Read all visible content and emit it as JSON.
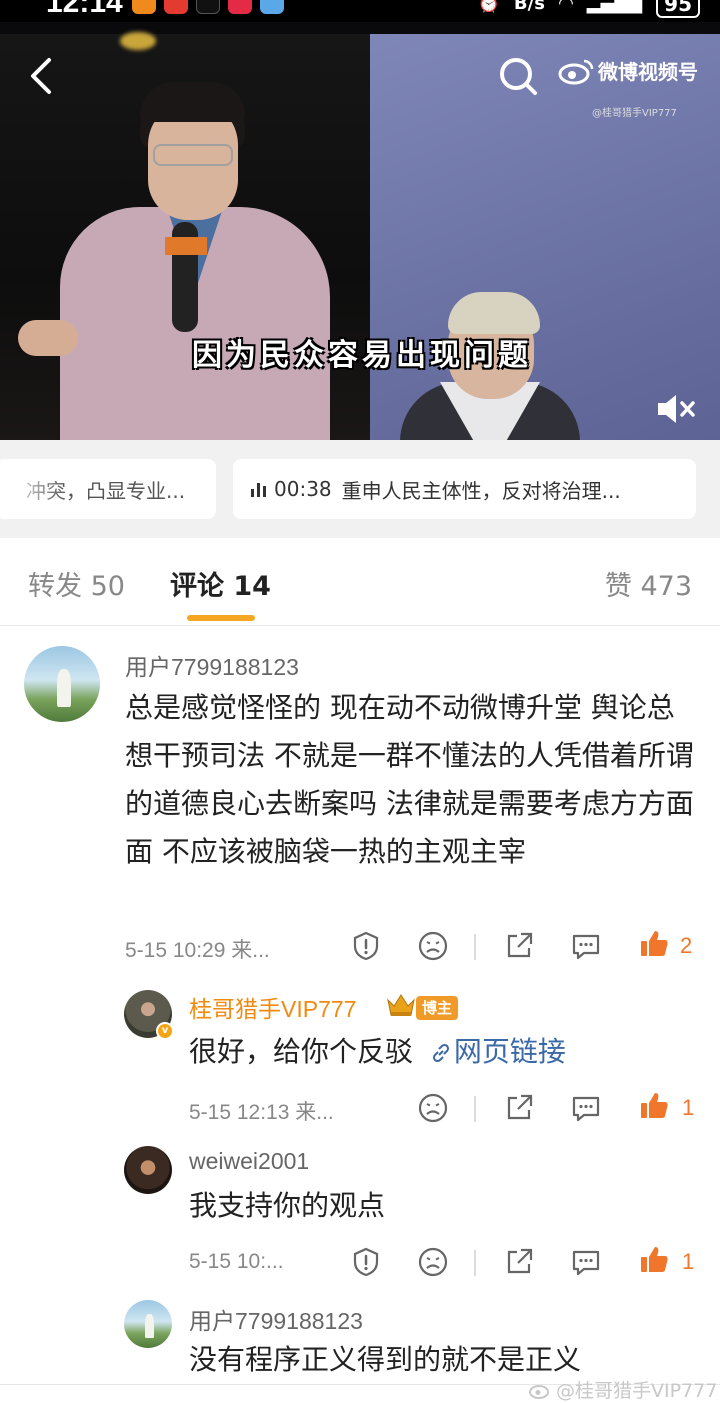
{
  "status_bar": {
    "time": "12:14",
    "net_speed": "B/s",
    "battery": "95"
  },
  "video": {
    "caption": "因为民众容易出现问题",
    "brand_name": "微博视频号",
    "brand_sub": "@桂哥猎手VIP777",
    "colors": {
      "right_backdrop": "#6d74a6"
    }
  },
  "chapters": [
    {
      "text": "冲突，凸显专业..."
    },
    {
      "time": "00:38",
      "text": "重申人民主体性，反对将治理..."
    }
  ],
  "tabs": {
    "repost": "转发 50",
    "comments": "评论 14",
    "likes": "赞 473"
  },
  "comments": [
    {
      "user": "用户7799188123",
      "text": "总是感觉怪怪的 现在动不动微博升堂 舆论总想干预司法 不就是一群不懂法的人凭借着所谓的道德良心去断案吗 法律就是需要考虑方方面面 不应该被脑袋一热的主观主宰",
      "time": "5-15 10:29 来...",
      "likes": "2"
    }
  ],
  "replies": [
    {
      "user": "桂哥猎手VIP777",
      "badge": "博主",
      "text": "很好，给你个反驳",
      "link_text": "网页链接",
      "time": "5-15 12:13 来...",
      "likes": "1"
    },
    {
      "user": "weiwei2001",
      "text": "我支持你的观点",
      "time": "5-15 10:...",
      "likes": "1"
    },
    {
      "user": "用户7799188123",
      "text": "没有程序正义得到的就不是正义"
    }
  ],
  "watermark": "@桂哥猎手VIP777",
  "accent": {
    "tab_underline": "#f5a623",
    "like": "#f0762b",
    "username_highlight": "#f18a12",
    "link": "#3b69a8"
  }
}
